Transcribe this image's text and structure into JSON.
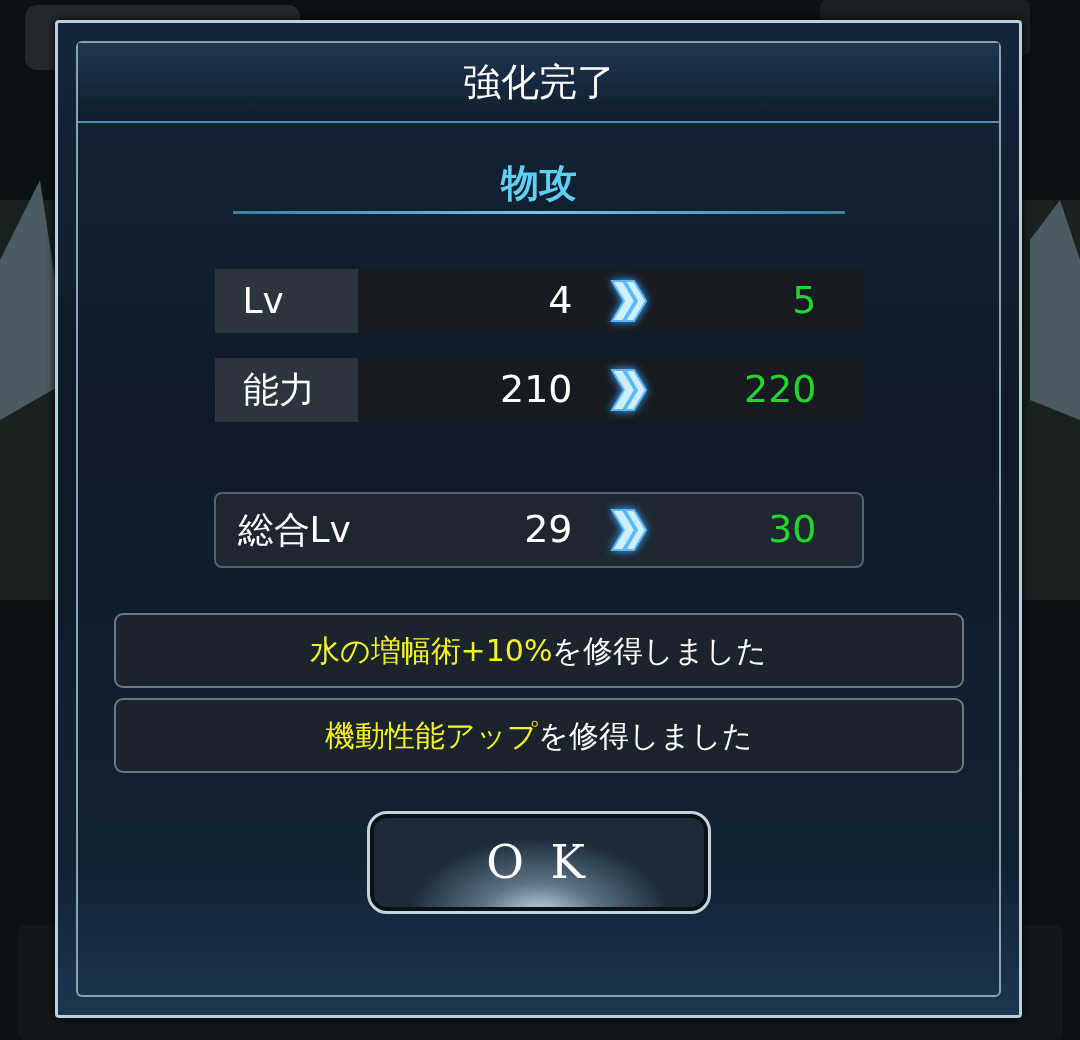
{
  "dialog": {
    "title": "強化完了",
    "subtitle": "物攻",
    "stats": [
      {
        "label": "Lv",
        "before": "4",
        "after": "5"
      },
      {
        "label": "能力",
        "before": "210",
        "after": "220"
      }
    ],
    "total": {
      "label": "総合Lv",
      "before": "29",
      "after": "30"
    },
    "messages": [
      {
        "highlight": "水の増幅術+10%",
        "text": "を修得しました"
      },
      {
        "highlight": "機動性能アップ",
        "text": "を修得しました"
      }
    ],
    "ok_button": "O K"
  }
}
